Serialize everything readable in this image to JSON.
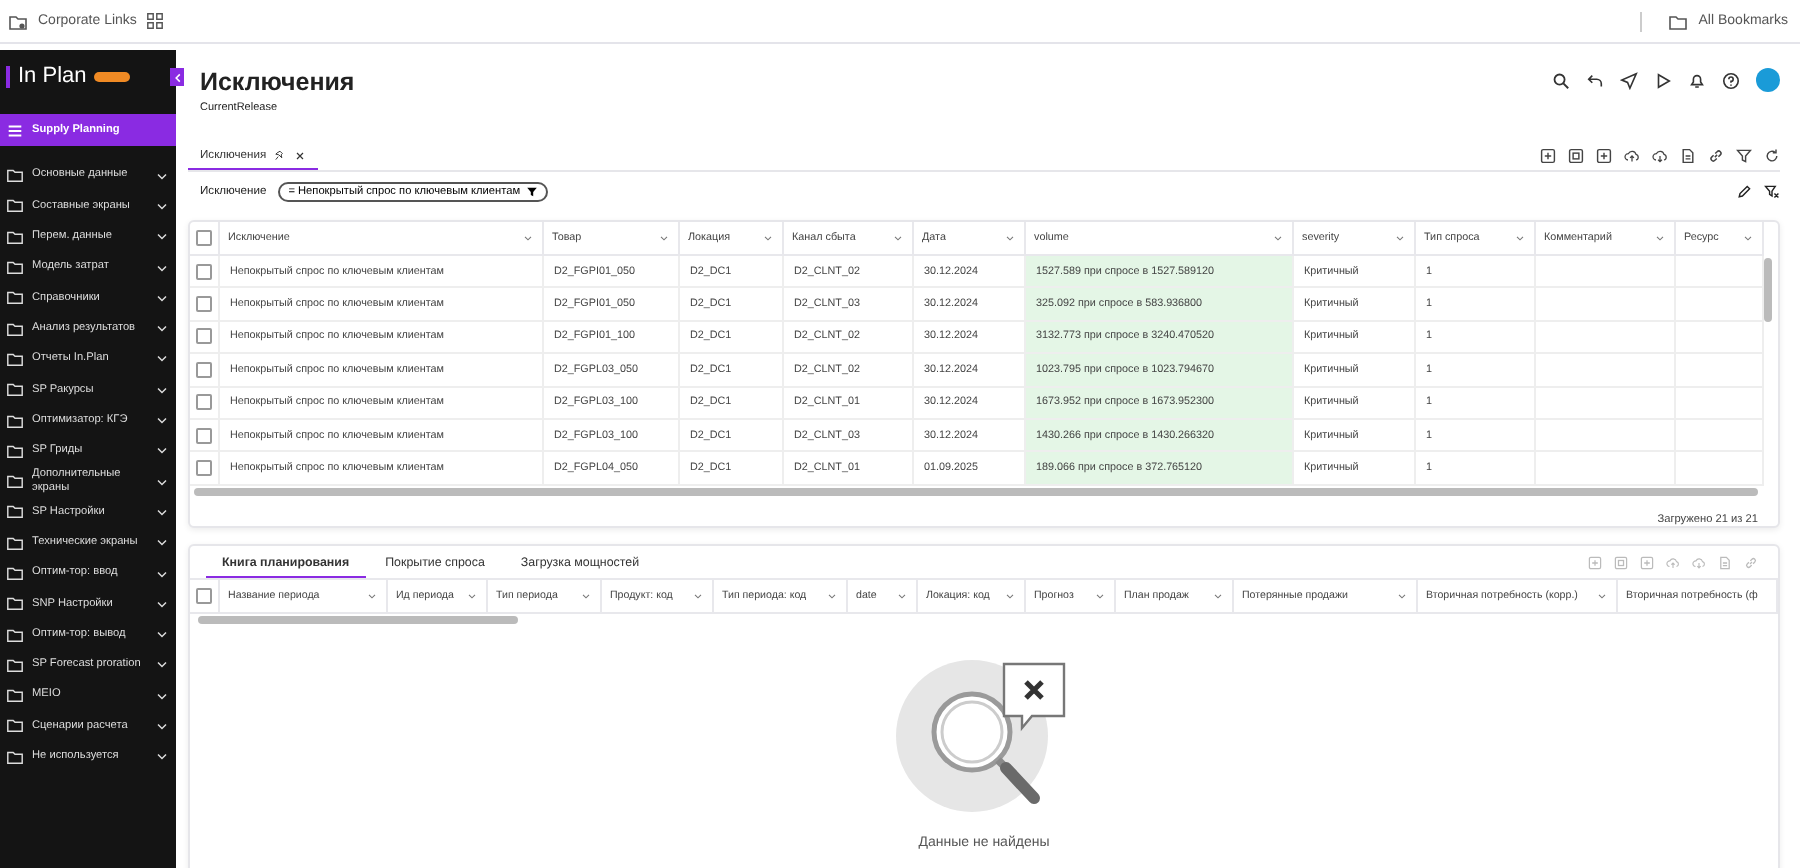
{
  "topbar": {
    "links_label": "Corporate Links",
    "bookmarks_label": "All Bookmarks"
  },
  "sidebar": {
    "logo": "In Plan",
    "items": [
      {
        "label": "Supply Planning",
        "kind": "module",
        "selected": true
      },
      {
        "label": "Основные данные",
        "kind": "folder",
        "selected": false
      },
      {
        "label": "Составные экраны",
        "kind": "folder",
        "selected": false
      },
      {
        "label": "Перем. данные",
        "kind": "folder",
        "selected": false
      },
      {
        "label": "Модель затрат",
        "kind": "folder",
        "selected": false
      },
      {
        "label": "Справочники",
        "kind": "folder",
        "selected": false
      },
      {
        "label": "Анализ результатов",
        "kind": "folder",
        "selected": false
      },
      {
        "label": "Отчеты In.Plan",
        "kind": "folder",
        "selected": false
      },
      {
        "label": "SP Ракурсы",
        "kind": "folder",
        "selected": false
      },
      {
        "label": "Оптимизатор: КГЭ",
        "kind": "folder",
        "selected": false
      },
      {
        "label": "SP Гриды",
        "kind": "folder",
        "selected": false
      },
      {
        "label": "Дополнительные экраны",
        "kind": "folder",
        "selected": false
      },
      {
        "label": "SP Настройки",
        "kind": "folder",
        "selected": false
      },
      {
        "label": "Технические экраны",
        "kind": "folder",
        "selected": false
      },
      {
        "label": "Оптим-тор: ввод",
        "kind": "folder",
        "selected": false
      },
      {
        "label": "SNP Настройки",
        "kind": "folder",
        "selected": false
      },
      {
        "label": "Оптим-тор: вывод",
        "kind": "folder",
        "selected": false
      },
      {
        "label": "SP Forecast proration",
        "kind": "folder",
        "selected": false
      },
      {
        "label": "MEIO",
        "kind": "folder",
        "selected": false
      },
      {
        "label": "Сценарии расчета",
        "kind": "folder",
        "selected": false
      },
      {
        "label": "Не используется",
        "kind": "folder",
        "selected": false
      }
    ]
  },
  "header": {
    "title": "Исключения",
    "subtitle": "CurrentRelease"
  },
  "tabs": [
    {
      "label": "Исключения",
      "selected": true
    }
  ],
  "filter": {
    "label": "Исключение",
    "chip": "= Непокрытый спрос по ключевым клиентам"
  },
  "table": {
    "columns": [
      {
        "label": "Исключение",
        "highlighted": false
      },
      {
        "label": "Товар",
        "highlighted": false
      },
      {
        "label": "Локация",
        "highlighted": false
      },
      {
        "label": "Канал сбыта",
        "highlighted": false
      },
      {
        "label": "Дата",
        "highlighted": false
      },
      {
        "label": "volume",
        "highlighted": true
      },
      {
        "label": "severity",
        "highlighted": false
      },
      {
        "label": "Тип спроса",
        "highlighted": false
      },
      {
        "label": "Комментарий",
        "highlighted": false
      },
      {
        "label": "Ресурс",
        "highlighted": false
      }
    ],
    "rows": [
      {
        "checked": false,
        "cells": [
          "Непокрытый спрос по ключевым клиентам",
          "D2_FGPI01_050",
          "D2_DC1",
          "D2_CLNT_02",
          "30.12.2024",
          "1527.589 при спросе в 1527.589120",
          "Критичный",
          "1"
        ]
      },
      {
        "checked": false,
        "cells": [
          "Непокрытый спрос по ключевым клиентам",
          "D2_FGPI01_050",
          "D2_DC1",
          "D2_CLNT_03",
          "30.12.2024",
          "325.092 при спросе в 583.936800",
          "Критичный",
          "1"
        ]
      },
      {
        "checked": false,
        "cells": [
          "Непокрытый спрос по ключевым клиентам",
          "D2_FGPI01_100",
          "D2_DC1",
          "D2_CLNT_02",
          "30.12.2024",
          "3132.773 при спросе в 3240.470520",
          "Критичный",
          "1"
        ]
      },
      {
        "checked": false,
        "cells": [
          "Непокрытый спрос по ключевым клиентам",
          "D2_FGPL03_050",
          "D2_DC1",
          "D2_CLNT_02",
          "30.12.2024",
          "1023.795 при спросе в 1023.794670",
          "Критичный",
          "1"
        ]
      },
      {
        "checked": false,
        "cells": [
          "Непокрытый спрос по ключевым клиентам",
          "D2_FGPL03_100",
          "D2_DC1",
          "D2_CLNT_01",
          "30.12.2024",
          "1673.952 при спросе в 1673.952300",
          "Критичный",
          "1"
        ]
      },
      {
        "checked": false,
        "cells": [
          "Непокрытый спрос по ключевым клиентам",
          "D2_FGPL03_100",
          "D2_DC1",
          "D2_CLNT_03",
          "30.12.2024",
          "1430.266 при спросе в 1430.266320",
          "Критичный",
          "1"
        ]
      },
      {
        "checked": false,
        "cells": [
          "Непокрытый спрос по ключевым клиентам",
          "D2_FGPL04_050",
          "D2_DC1",
          "D2_CLNT_01",
          "01.09.2025",
          "189.066 при спросе в 372.765120",
          "Критичный",
          "1"
        ]
      }
    ],
    "footer": "Загружено 21 из 21",
    "all_checked": false
  },
  "bottom": {
    "tabs": [
      {
        "label": "Книга планирования",
        "selected": true
      },
      {
        "label": "Покрытие спроса",
        "selected": false
      },
      {
        "label": "Загрузка мощностей",
        "selected": false
      }
    ],
    "columns": [
      "Название периода",
      "Ид периода",
      "Тип периода",
      "Продукт: код",
      "Тип периода: код",
      "date",
      "Локация: код",
      "Прогноз",
      "План продаж",
      "Потерянные продажи",
      "Вторичная потребность (корр.)",
      "Вторичная потребность (ф"
    ],
    "empty_text": "Данные не найдены",
    "all_checked": false
  }
}
